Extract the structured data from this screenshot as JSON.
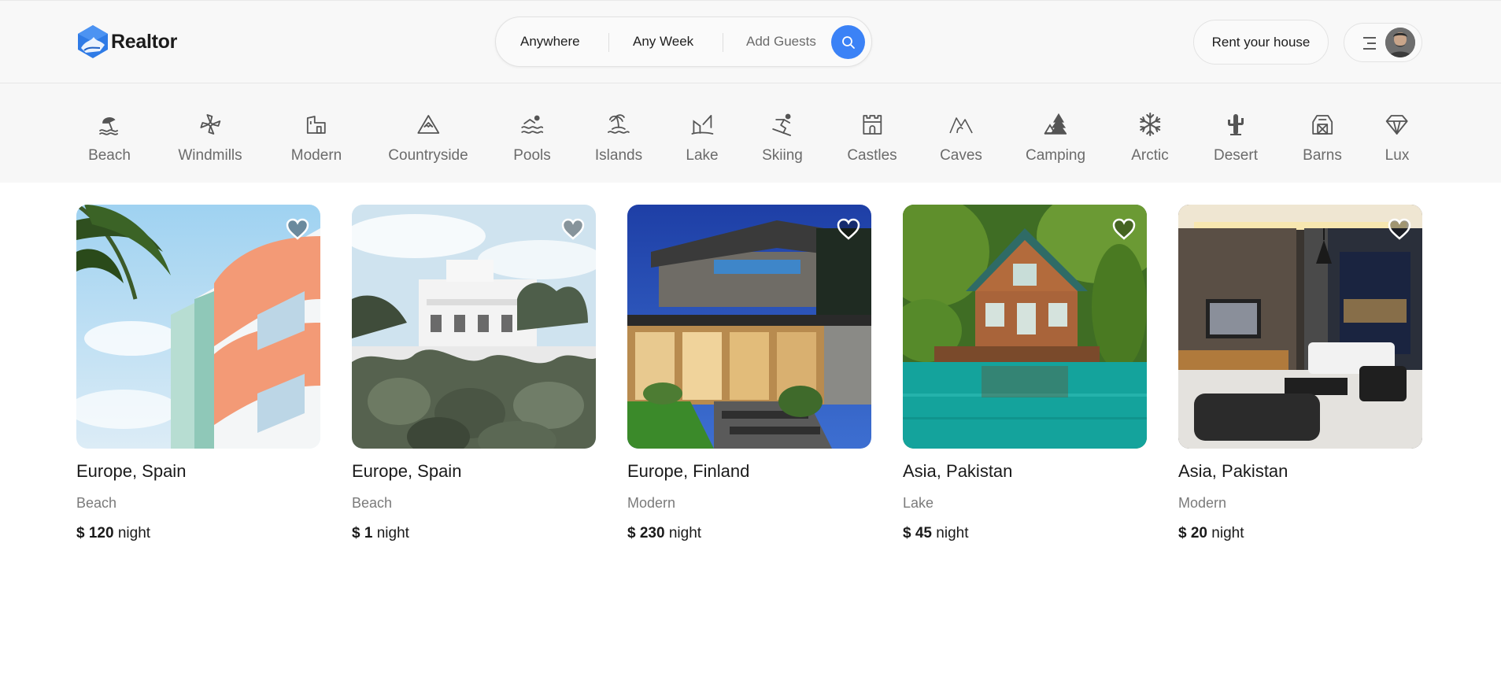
{
  "app": {
    "brand": "Realtor",
    "brand_color": "#3b82f6"
  },
  "search": {
    "where": "Anywhere",
    "when": "Any Week",
    "guests": "Add Guests",
    "button_icon": "search-icon"
  },
  "header": {
    "rent_label": "Rent your house",
    "menu_icon": "menu-icon",
    "avatar_icon": "avatar"
  },
  "categories": [
    {
      "label": "Beach",
      "icon": "beach-icon"
    },
    {
      "label": "Windmills",
      "icon": "windmill-icon"
    },
    {
      "label": "Modern",
      "icon": "modern-house-icon"
    },
    {
      "label": "Countryside",
      "icon": "mountain-icon"
    },
    {
      "label": "Pools",
      "icon": "pool-icon"
    },
    {
      "label": "Islands",
      "icon": "island-icon"
    },
    {
      "label": "Lake",
      "icon": "lake-icon"
    },
    {
      "label": "Skiing",
      "icon": "skiing-icon"
    },
    {
      "label": "Castles",
      "icon": "castle-icon"
    },
    {
      "label": "Caves",
      "icon": "cave-icon"
    },
    {
      "label": "Camping",
      "icon": "camping-icon"
    },
    {
      "label": "Arctic",
      "icon": "snowflake-icon"
    },
    {
      "label": "Desert",
      "icon": "cactus-icon"
    },
    {
      "label": "Barns",
      "icon": "barn-icon"
    },
    {
      "label": "Lux",
      "icon": "diamond-icon"
    }
  ],
  "listings": [
    {
      "location": "Europe, Spain",
      "category": "Beach",
      "currency": "$",
      "price": "120",
      "unit": "night",
      "favorite_icon": "heart-icon"
    },
    {
      "location": "Europe, Spain",
      "category": "Beach",
      "currency": "$",
      "price": "1",
      "unit": "night",
      "favorite_icon": "heart-icon"
    },
    {
      "location": "Europe, Finland",
      "category": "Modern",
      "currency": "$",
      "price": "230",
      "unit": "night",
      "favorite_icon": "heart-icon"
    },
    {
      "location": "Asia, Pakistan",
      "category": "Lake",
      "currency": "$",
      "price": "45",
      "unit": "night",
      "favorite_icon": "heart-icon"
    },
    {
      "location": "Asia, Pakistan",
      "category": "Modern",
      "currency": "$",
      "price": "20",
      "unit": "night",
      "favorite_icon": "heart-icon"
    }
  ]
}
